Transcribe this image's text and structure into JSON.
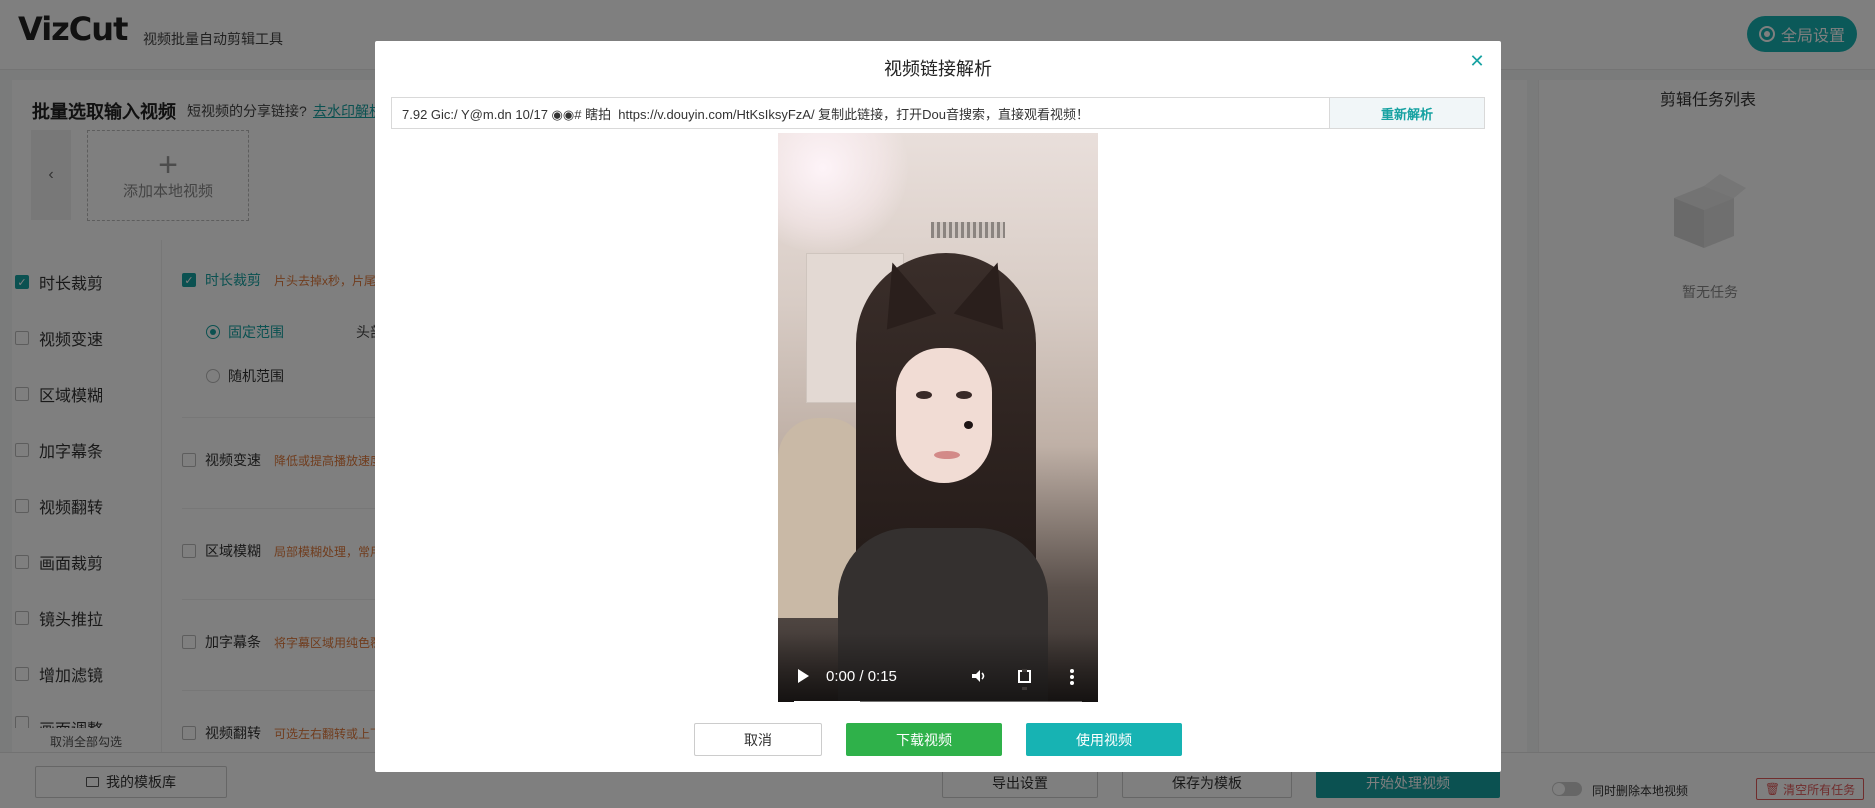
{
  "app": {
    "logo": "VizCut",
    "subtitle": "视频批量自动剪辑工具",
    "global_settings": "全局设置"
  },
  "main": {
    "batch_title": "批量选取输入视频",
    "share_question": "短视频的分享链接?",
    "share_link": "去水印解析",
    "add_local": "添加本地视频"
  },
  "sidebar": {
    "items": [
      {
        "label": "时长裁剪",
        "checked": true
      },
      {
        "label": "视频变速",
        "checked": false
      },
      {
        "label": "区域模糊",
        "checked": false
      },
      {
        "label": "加字幕条",
        "checked": false
      },
      {
        "label": "视频翻转",
        "checked": false
      },
      {
        "label": "画面裁剪",
        "checked": false
      },
      {
        "label": "镜头推拉",
        "checked": false
      },
      {
        "label": "增加滤镜",
        "checked": false
      },
      {
        "label": "画面调整",
        "checked": false
      }
    ],
    "unselect_all": "取消全部勾选"
  },
  "options": {
    "trim": {
      "label": "时长裁剪",
      "desc": "片头去掉x秒，片尾"
    },
    "fixed_range": "固定范围",
    "random_range": "随机范围",
    "head": "头部",
    "speed": {
      "label": "视频变速",
      "desc": "降低或提高播放速度"
    },
    "blur": {
      "label": "区域模糊",
      "desc": "局部模糊处理，常用"
    },
    "subtitle": {
      "label": "加字幕条",
      "desc": "将字幕区域用纯色覆"
    },
    "flip": {
      "label": "视频翻转",
      "desc": "可选左右翻转或上下"
    }
  },
  "tasks": {
    "title": "剪辑任务列表",
    "empty": "暂无任务"
  },
  "footer": {
    "template_lib": "我的模板库",
    "export_settings": "导出设置",
    "save_template": "保存为模板",
    "start": "开始处理视频",
    "delete_local": "同时删除本地视频",
    "clear_all": "清空所有任务"
  },
  "modal": {
    "title": "视频链接解析",
    "url_value": "7.92 Gic:/ Y@m.dn 10/17 ◉◉# 瞎拍  https://v.douyin.com/HtKsIksyFzA/ 复制此链接，打开Dou音搜索，直接观看视频！",
    "reparse": "重新解析",
    "video": {
      "time": "0:00 / 0:15",
      "progress": 0.23
    },
    "cancel": "取消",
    "download": "下载视频",
    "use": "使用视频"
  },
  "colors": {
    "accent": "#17a2a2",
    "green": "#2fb14a",
    "warn": "#e07a3c"
  }
}
